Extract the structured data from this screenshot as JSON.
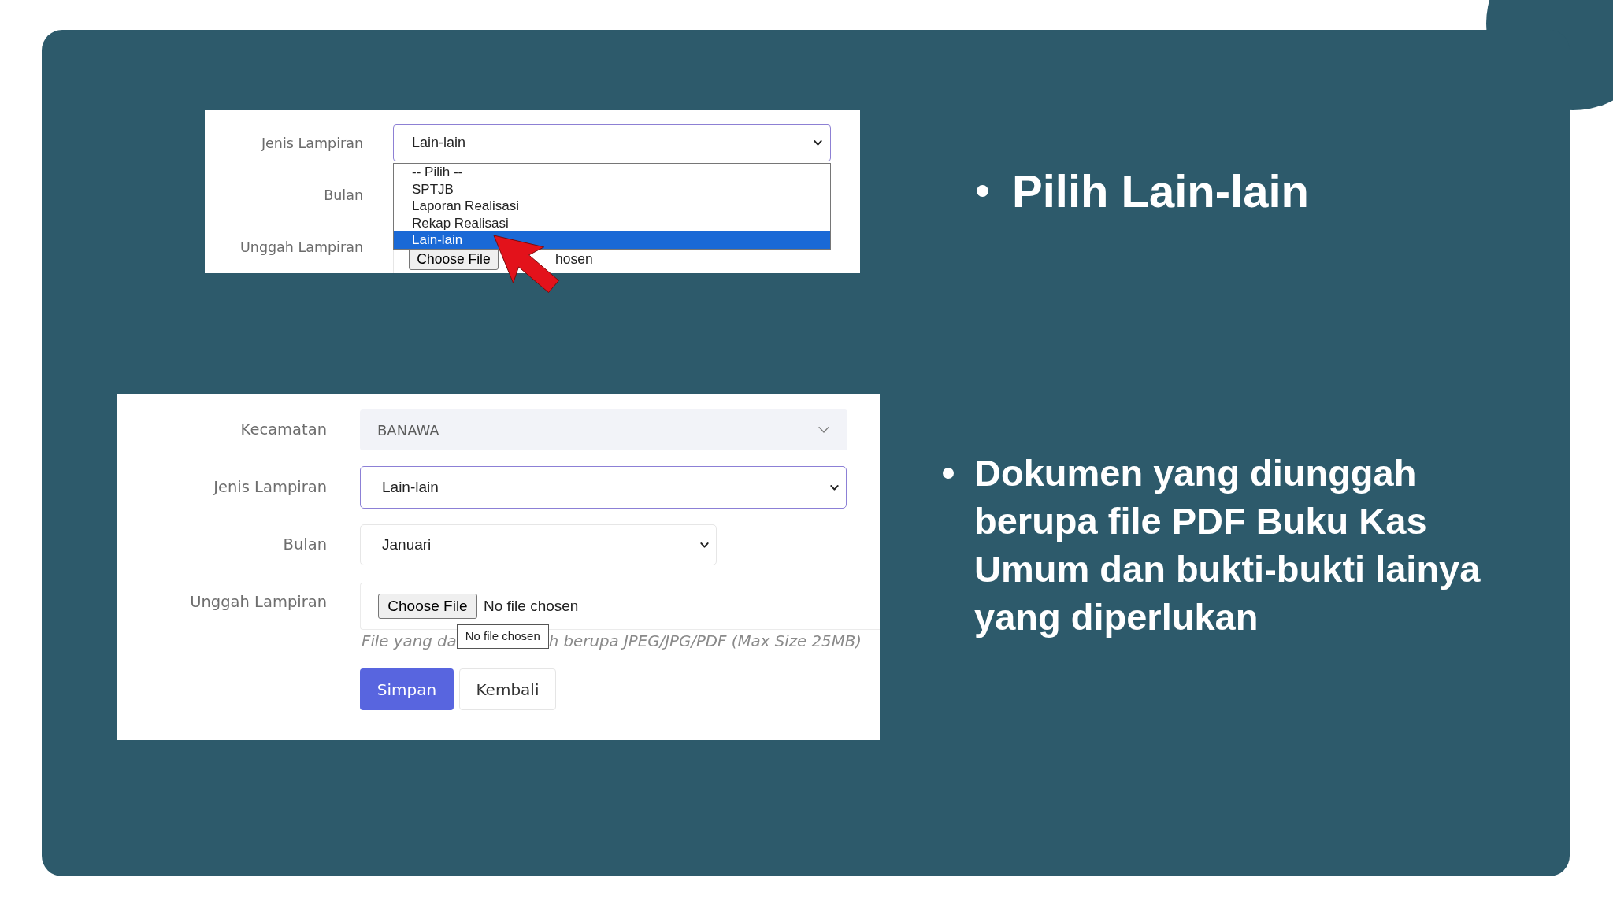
{
  "dropdown_screenshot": {
    "attachment_type": {
      "label": "Jenis Lampiran",
      "value": "Lain-lain",
      "focused": true,
      "expanded": true,
      "options": [
        {
          "label": "-- Pilih --",
          "selected": false
        },
        {
          "label": "SPTJB",
          "selected": false
        },
        {
          "label": "Laporan Realisasi",
          "selected": false
        },
        {
          "label": "Rekap Realisasi",
          "selected": false
        },
        {
          "label": "Lain-lain",
          "selected": true
        }
      ]
    },
    "month": {
      "label": "Bulan"
    },
    "upload": {
      "label": "Unggah Lampiran",
      "button": "Choose File",
      "status": "hosen"
    }
  },
  "form_screenshot": {
    "fields": [
      {
        "kind": "readonly_select",
        "label": "Kecamatan",
        "value": "BANAWA"
      },
      {
        "kind": "select",
        "label": "Jenis Lampiran",
        "value": "Lain-lain",
        "focused": true
      },
      {
        "kind": "select",
        "label": "Bulan",
        "value": "Januari",
        "focused": false
      },
      {
        "kind": "file",
        "label": "Unggah Lampiran",
        "button": "Choose File",
        "status": "No file chosen"
      }
    ],
    "tooltip": "No file chosen",
    "help_text": [
      "File yang da",
      "h berupa JPEG/JPG/PDF (Max Size 25MB)"
    ],
    "buttons": [
      {
        "kind": "primary",
        "label": "Simpan"
      },
      {
        "kind": "secondary",
        "label": "Kembali"
      }
    ]
  },
  "bullet_points": [
    {
      "text": "Pilih Lain-lain"
    },
    {
      "text": "Dokumen yang diunggah berupa file PDF Buku Kas Umum dan bukti-bukti lainya yang diperlukan"
    }
  ]
}
